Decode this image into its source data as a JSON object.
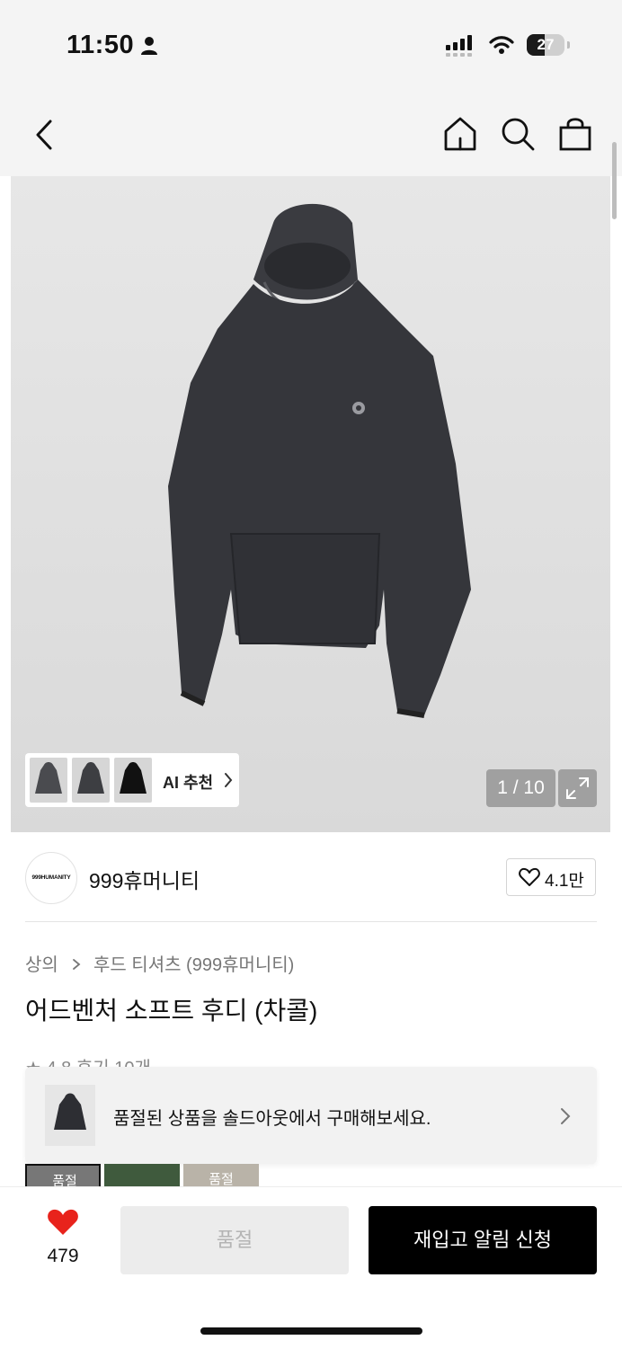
{
  "status_bar": {
    "time": "11:50",
    "battery": "27"
  },
  "nav": {
    "back_icon": "chevron-left-icon",
    "home_icon": "home-icon",
    "search_icon": "search-icon",
    "bag_icon": "shopping-bag-icon"
  },
  "gallery": {
    "counter": "1 / 10",
    "ai_label": "AI 추천",
    "expand_icon": "expand-icon"
  },
  "brand": {
    "logo_text": "999HUMANITY",
    "name": "999휴머니티",
    "likes": "4.1만"
  },
  "breadcrumb": {
    "level1": "상의",
    "level2": "후드 티셔츠 (999휴머니티)"
  },
  "product": {
    "title": "어드벤처 소프트 후디 (차콜)",
    "rating_peek": "★ 4.8  후기 10개"
  },
  "toast": {
    "text": "품절된 상품을 솔드아웃에서 구매해보세요."
  },
  "swatches": [
    {
      "label": "품절"
    },
    {
      "label": ""
    },
    {
      "label": "품절"
    }
  ],
  "bottom_bar": {
    "heart_count": "479",
    "soldout_label": "품절",
    "restock_label": "재입고 알림 신청"
  },
  "colors": {
    "accent_heart": "#e8231c",
    "primary_button": "#000000",
    "disabled_button": "#ececec"
  }
}
